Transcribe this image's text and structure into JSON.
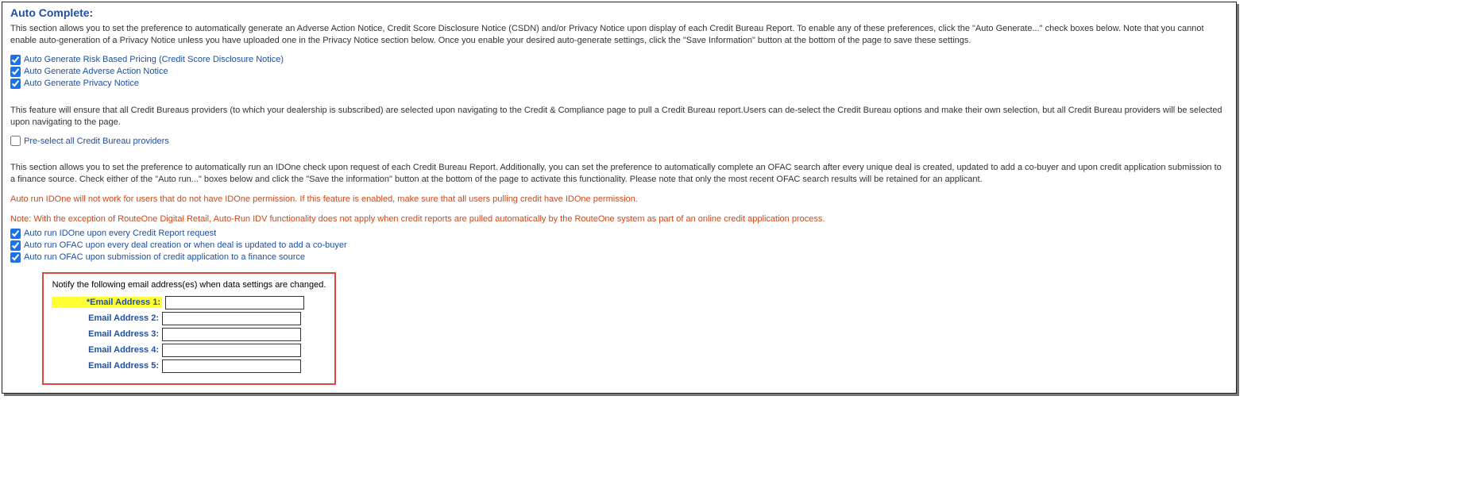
{
  "title": "Auto Complete:",
  "desc1": "This section allows you to set the preference to automatically generate an Adverse Action Notice, Credit Score Disclosure Notice (CSDN) and/or Privacy Notice upon display of each Credit Bureau Report. To enable any of these preferences, click the \"Auto Generate...\" check boxes below. Note that you cannot enable auto-generation of a Privacy Notice unless you have uploaded one in the Privacy Notice section below. Once you enable your desired auto-generate settings, click the \"Save Information\" button at the bottom of the page to save these settings.",
  "chk1": {
    "label": "Auto Generate Risk Based Pricing (Credit Score Disclosure Notice)",
    "checked": true
  },
  "chk2": {
    "label": "Auto Generate Adverse Action Notice",
    "checked": true
  },
  "chk3": {
    "label": "Auto Generate Privacy Notice",
    "checked": true
  },
  "desc2": "This feature will ensure that all Credit Bureaus providers (to which your dealership is subscribed) are selected upon navigating to the Credit & Compliance page to pull a Credit Bureau report.Users can de-select the Credit Bureau options and make their own selection, but all Credit Bureau providers will be selected upon navigating to the page.",
  "chk4": {
    "label": "Pre-select all Credit Bureau providers",
    "checked": false
  },
  "desc3": "This section allows you to set the preference to automatically run an IDOne check upon request of each Credit Bureau Report. Additionally, you can set the preference to automatically complete an OFAC search after every unique deal is created, updated to add a co-buyer and upon credit application submission to a finance source. Check either of the \"Auto run...\" boxes below and click the \"Save the information\" button at the bottom of the page to activate this functionality. Please note that only the most recent OFAC search results will be retained for an applicant.",
  "warn1": "Auto run IDOne will not work for users that do not have IDOne permission. If this feature is enabled, make sure that all users pulling credit have IDOne permission.",
  "warn2": "Note: With the exception of RouteOne Digital Retail, Auto-Run IDV functionality does not apply when credit reports are pulled automatically by the RouteOne system as part of an online credit application process.",
  "chk5": {
    "label": "Auto run IDOne upon every Credit Report request",
    "checked": true
  },
  "chk6": {
    "label": "Auto run OFAC upon every deal creation or when deal is updated to add a co-buyer",
    "checked": true
  },
  "chk7": {
    "label": "Auto run OFAC upon submission of credit application to a finance source",
    "checked": true
  },
  "emailBox": {
    "title": "Notify the following email address(es) when data settings are changed.",
    "rows": [
      {
        "label": "*Email Address 1:",
        "required": true,
        "value": ""
      },
      {
        "label": "Email Address 2:",
        "required": false,
        "value": ""
      },
      {
        "label": "Email Address 3:",
        "required": false,
        "value": ""
      },
      {
        "label": "Email Address 4:",
        "required": false,
        "value": ""
      },
      {
        "label": "Email Address 5:",
        "required": false,
        "value": ""
      }
    ]
  }
}
